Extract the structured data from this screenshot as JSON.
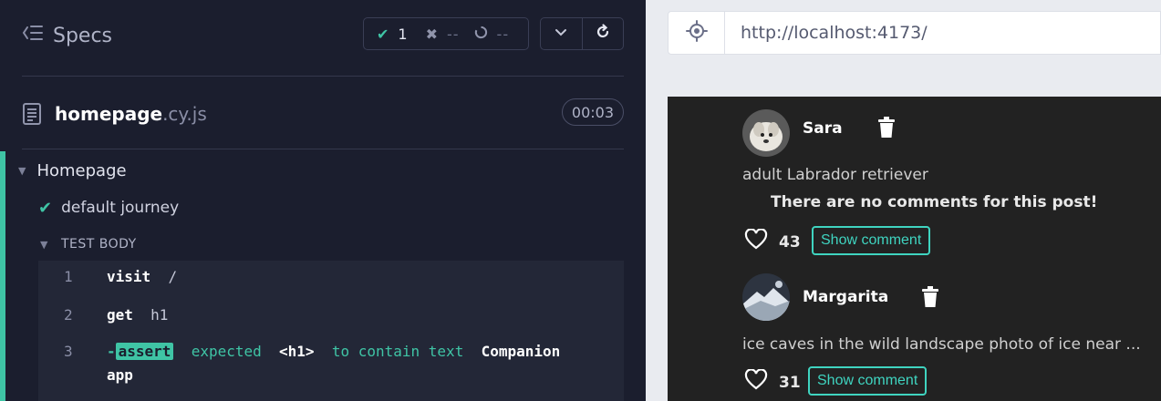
{
  "reporter": {
    "specs_label": "Specs",
    "stats": {
      "passed": "1",
      "failed": "--",
      "pending": "--"
    },
    "file": {
      "name": "homepage",
      "ext": ".cy.js",
      "duration": "00:03"
    },
    "suite": "Homepage",
    "test": "default journey",
    "test_body_label": "TEST BODY",
    "commands": [
      {
        "num": "1",
        "name": "visit",
        "arg": "/"
      },
      {
        "num": "2",
        "name": "get",
        "arg": "h1"
      },
      {
        "num": "3",
        "dash": "-",
        "name": "assert",
        "expected": "expected",
        "selector": "<h1>",
        "to_contain": "to contain text",
        "value_line1": "Companion",
        "value_line2": "app"
      }
    ]
  },
  "aut": {
    "url": "http://localhost:4173/",
    "posts": [
      {
        "author": "Sara",
        "caption": "adult Labrador retriever",
        "no_comments": "There are no comments for this post!",
        "likes": "43",
        "show_comment": "Show comment"
      },
      {
        "author": "Margarita",
        "caption": "ice caves in the wild landscape photo of ice near ...",
        "likes": "31",
        "show_comment": "Show comment"
      }
    ]
  },
  "colors": {
    "reporter_bg": "#1b1e2e",
    "accent_teal": "#3fc4a5",
    "aut_bg": "#222222",
    "button_teal": "#3fd4c0"
  }
}
